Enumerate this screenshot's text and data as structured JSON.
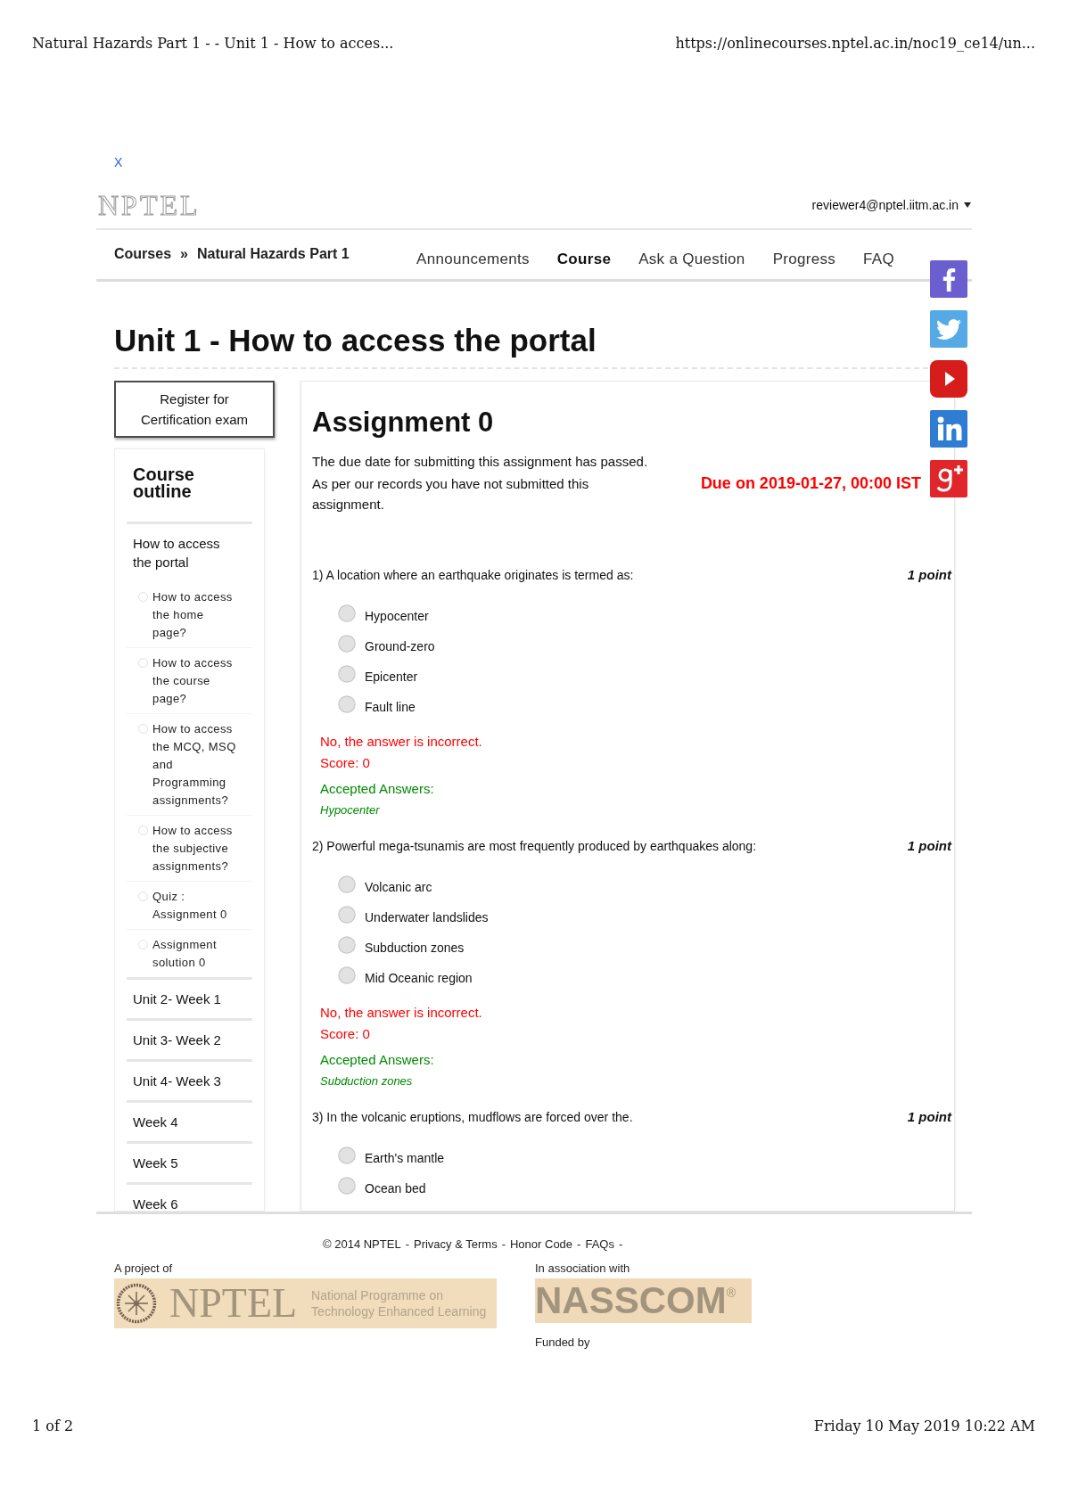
{
  "print_header": {
    "page_title": "Natural Hazards Part 1 - - Unit 1 - How to acces...",
    "url": "https://onlinecourses.nptel.ac.in/noc19_ce14/un..."
  },
  "close_link": "X",
  "header": {
    "logo": "NPTEL",
    "user_email": "reviewer4@nptel.iitm.ac.in"
  },
  "breadcrumb": {
    "items": [
      "Courses",
      "Natural Hazards Part 1"
    ],
    "separator": "»"
  },
  "nav_tabs": [
    {
      "label": "Announcements",
      "selected": false
    },
    {
      "label": "Course",
      "selected": true
    },
    {
      "label": "Ask a Question",
      "selected": false
    },
    {
      "label": "Progress",
      "selected": false
    },
    {
      "label": "FAQ",
      "selected": false
    }
  ],
  "page_title": "Unit 1 - How to access the portal",
  "register_button": "Register for Certification exam",
  "course_outline": {
    "title": "Course outline",
    "units": [
      {
        "title": "How to access the portal",
        "children": [
          {
            "title": "How to access the home page?"
          },
          {
            "title": "How to access the course page?"
          },
          {
            "title": "How to access the MCQ, MSQ and Programming assignments?"
          },
          {
            "title": "How to access the subjective assignments?"
          },
          {
            "title": "Quiz : Assignment 0"
          },
          {
            "title": "Assignment solution 0"
          }
        ]
      },
      {
        "title": "Unit 2- Week 1"
      },
      {
        "title": "Unit 3- Week 2"
      },
      {
        "title": "Unit 4- Week 3"
      },
      {
        "title": "Week 4"
      },
      {
        "title": "Week 5"
      },
      {
        "title": "Week 6"
      }
    ]
  },
  "assignment": {
    "title": "Assignment 0",
    "notice": [
      "The due date for submitting this assignment has passed.",
      "As per our records you have not submitted this assignment."
    ],
    "due": "Due on 2019-01-27, 00:00 IST",
    "questions": [
      {
        "text": "1) A location where an earthquake originates is termed as:",
        "points": "1 point",
        "options": [
          {
            "label": "Hypocenter",
            "selected": false
          },
          {
            "label": "Ground-zero",
            "selected": false
          },
          {
            "label": "Epicenter",
            "selected": false
          },
          {
            "label": "Fault line",
            "selected": false
          }
        ],
        "correct": false,
        "result": "No, the answer is incorrect.",
        "score": "Score: 0",
        "accepted_label": "Accepted Answers:",
        "accepted_answer": "Hypocenter"
      },
      {
        "text": "2) Powerful mega-tsunamis are most frequently produced by earthquakes along:",
        "points": "1 point",
        "options": [
          {
            "label": "Volcanic arc",
            "selected": false
          },
          {
            "label": "Underwater landslides",
            "selected": false
          },
          {
            "label": "Subduction zones",
            "selected": false
          },
          {
            "label": "Mid Oceanic region",
            "selected": false
          }
        ],
        "correct": false,
        "result": "No, the answer is incorrect.",
        "score": "Score: 0",
        "accepted_label": "Accepted Answers:",
        "accepted_answer": "Subduction zones"
      },
      {
        "text": "3) In the volcanic eruptions, mudflows are forced over the.",
        "points": "1 point",
        "options": [
          {
            "label": "Earth's mantle",
            "selected": false
          },
          {
            "label": "Ocean bed",
            "selected": false
          }
        ]
      }
    ]
  },
  "social_icons": [
    {
      "kind": "facebook",
      "color": "#6b5fd0"
    },
    {
      "kind": "twitter",
      "color": "#55aae6"
    },
    {
      "kind": "youtube",
      "color": "#d71c1c"
    },
    {
      "kind": "linkedin",
      "color": "#2f7dd3"
    },
    {
      "kind": "googleplus",
      "color": "#e0262b"
    }
  ],
  "footer": {
    "copyright": "© 2014 NPTEL",
    "separator": "-",
    "links": [
      "Privacy & Terms",
      "Honor Code",
      "FAQs"
    ],
    "project_label": "A project of",
    "project_banner": {
      "name": "NPTEL",
      "tagline": [
        "National Programme on",
        "Technology Enhanced Learning"
      ]
    },
    "association_label": "In association with",
    "association_banner": "NASSCOM$^{®}$",
    "funded_label": "Funded by"
  },
  "print_footer": {
    "page": "1 of 2",
    "timestamp": "Friday 10 May 2019 10:22 AM"
  }
}
